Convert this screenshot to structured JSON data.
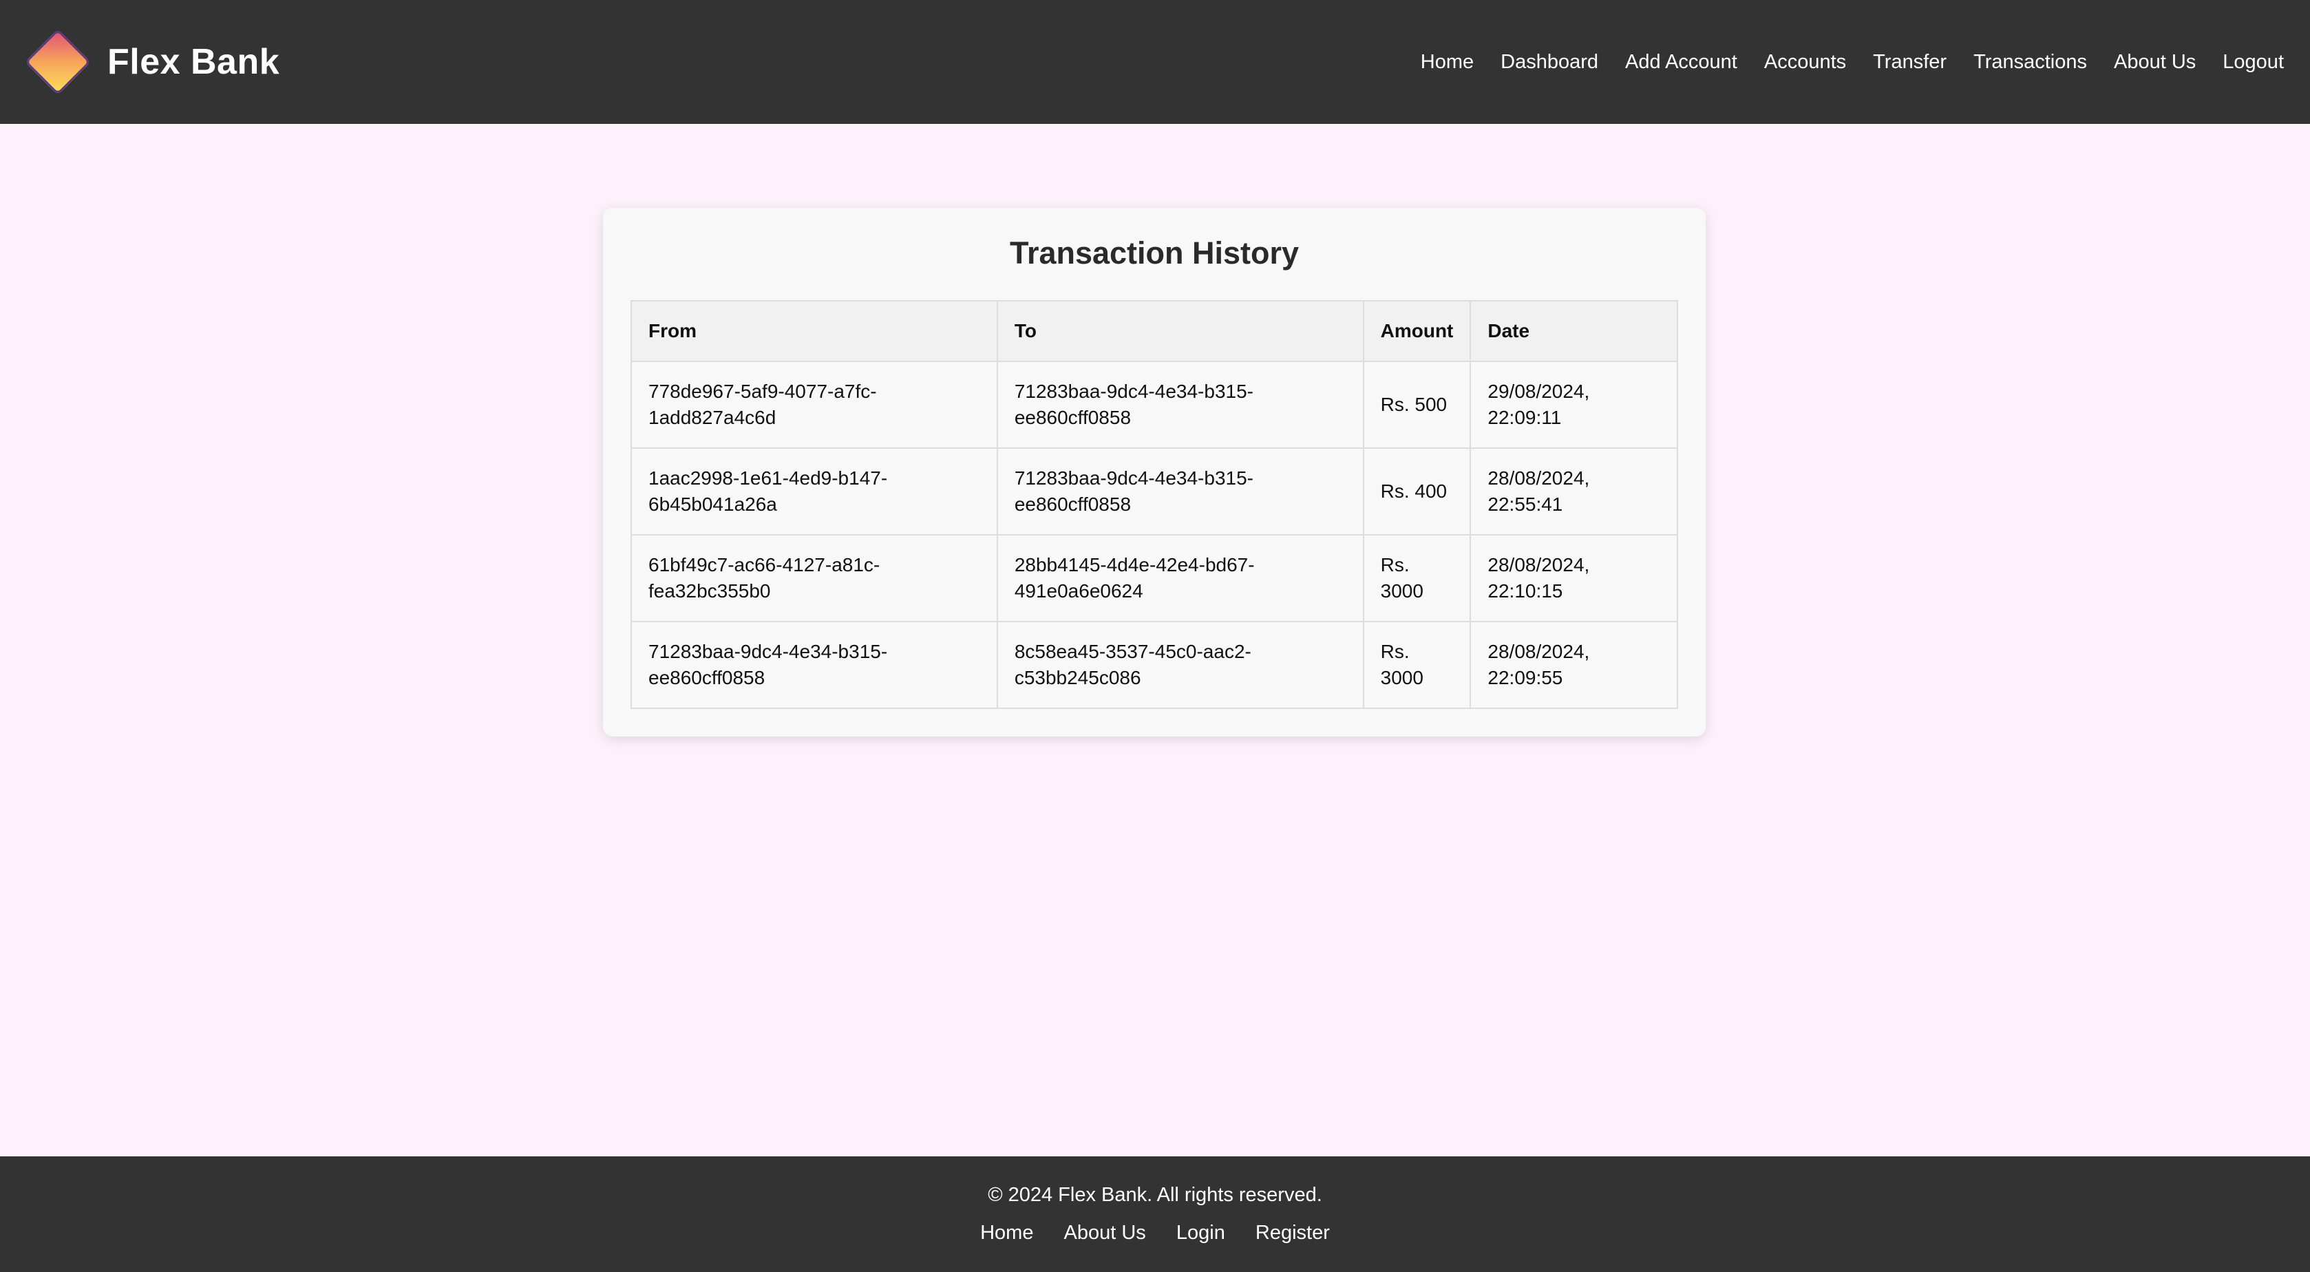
{
  "header": {
    "brand": "Flex Bank",
    "nav": [
      "Home",
      "Dashboard",
      "Add Account",
      "Accounts",
      "Transfer",
      "Transactions",
      "About Us",
      "Logout"
    ]
  },
  "main": {
    "title": "Transaction History",
    "columns": [
      "From",
      "To",
      "Amount",
      "Date"
    ],
    "rows": [
      {
        "from": [
          "778de967-5af9-4077-a7fc-",
          "1add827a4c6d"
        ],
        "to": [
          "71283baa-9dc4-4e34-b315-",
          "ee860cff0858"
        ],
        "amount": "Rs. 500",
        "date": [
          "29/08/2024,",
          "22:09:11"
        ]
      },
      {
        "from": [
          "1aac2998-1e61-4ed9-b147-",
          "6b45b041a26a"
        ],
        "to": [
          "71283baa-9dc4-4e34-b315-",
          "ee860cff0858"
        ],
        "amount": "Rs. 400",
        "date": [
          "28/08/2024,",
          "22:55:41"
        ]
      },
      {
        "from": [
          "61bf49c7-ac66-4127-a81c-",
          "fea32bc355b0"
        ],
        "to": [
          "28bb4145-4d4e-42e4-bd67-",
          "491e0a6e0624"
        ],
        "amount": "Rs. 3000",
        "date": [
          "28/08/2024,",
          "22:10:15"
        ]
      },
      {
        "from": [
          "71283baa-9dc4-4e34-b315-",
          "ee860cff0858"
        ],
        "to": [
          "8c58ea45-3537-45c0-aac2-",
          "c53bb245c086"
        ],
        "amount": "Rs. 3000",
        "date": [
          "28/08/2024,",
          "22:09:55"
        ]
      }
    ]
  },
  "footer": {
    "copyright": "© 2024 Flex Bank. All rights reserved.",
    "links": [
      "Home",
      "About Us",
      "Login",
      "Register"
    ]
  },
  "colors": {
    "header_bg": "#333333",
    "page_bg": "#fdf1fb",
    "card_bg": "#f8f8f8"
  }
}
